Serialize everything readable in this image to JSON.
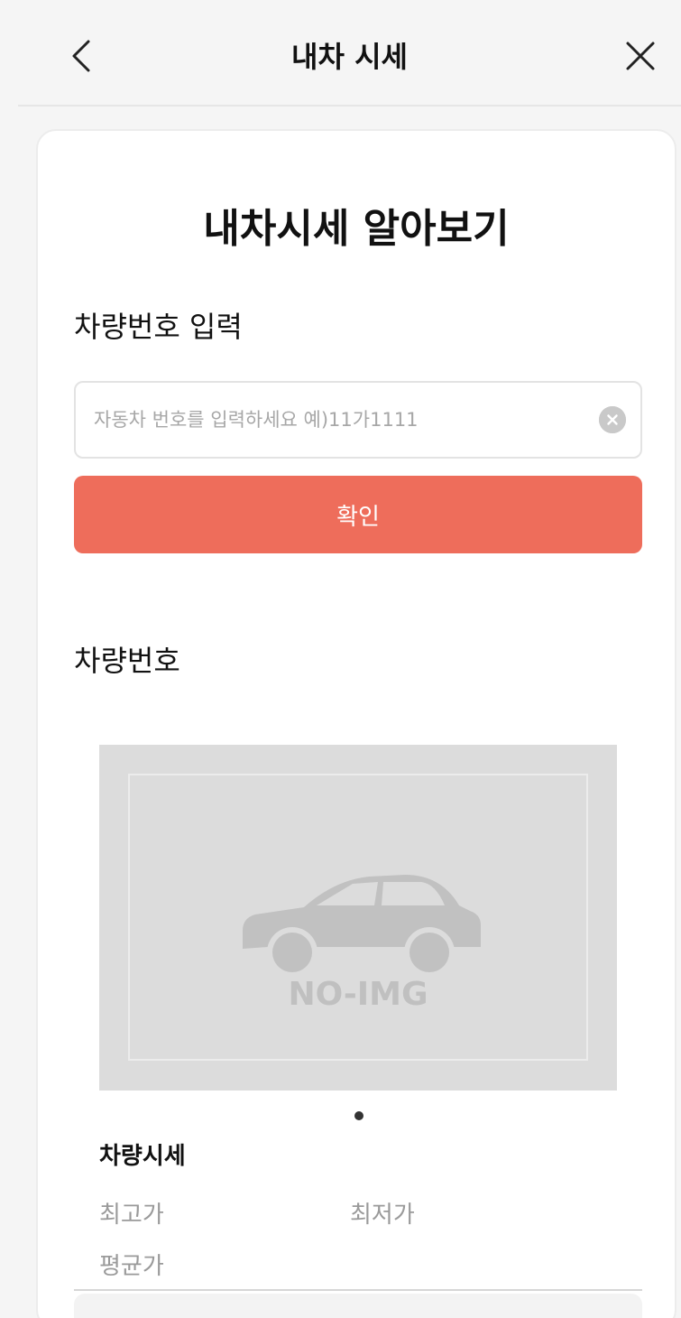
{
  "header": {
    "title": "내차 시세"
  },
  "page_title": "내차시세 알아보기",
  "input_section": {
    "label": "차량번호 입력",
    "placeholder": "자동차 번호를 입력하세요 예)11가1111",
    "value": "",
    "confirm_label": "확인"
  },
  "result_section": {
    "label": "차량번호",
    "no_image_text": "NO-IMG"
  },
  "price": {
    "title": "차량시세",
    "max_label": "최고가",
    "min_label": "최저가",
    "avg_label": "평균가"
  },
  "colors": {
    "accent": "#ee6d5b",
    "background": "#f5f5f5",
    "placeholder_image": "#dcdcdc"
  },
  "icons": {
    "back": "chevron-left-icon",
    "close": "close-icon",
    "clear": "clear-circle-icon",
    "car": "car-icon"
  }
}
